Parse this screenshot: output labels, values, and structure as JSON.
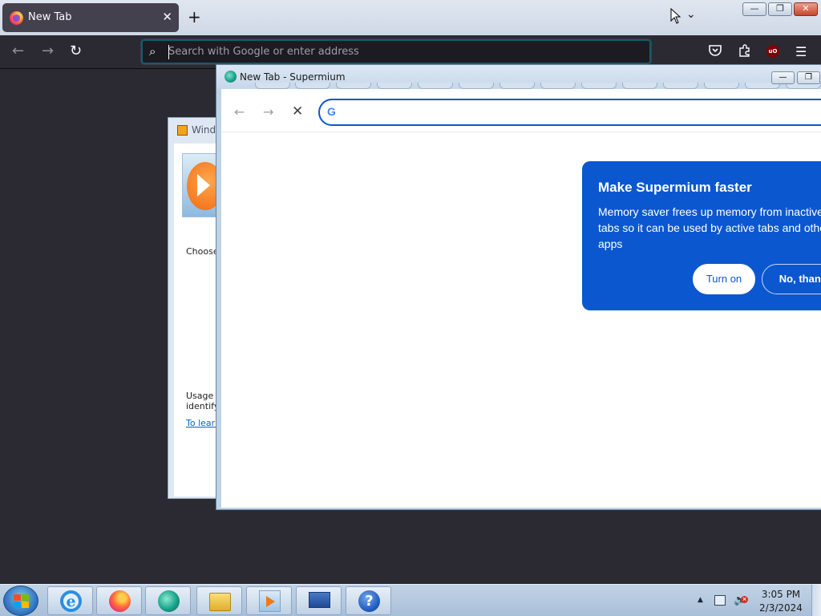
{
  "firefox": {
    "tab_title": "New Tab",
    "tab_close": "✕",
    "new_tab": "+",
    "list_all_tabs": "⌄",
    "window_controls": {
      "minimize": "—",
      "maximize": "❐",
      "close": "✕"
    },
    "nav": {
      "back": "←",
      "forward": "→",
      "reload": "↻"
    },
    "urlbar_placeholder": "Search with Google or enter address",
    "toolbar_icons": [
      "pocket-icon",
      "extensions-icon",
      "ublock-origin-icon",
      "menu-icon"
    ],
    "ublock_badge": "uO",
    "menu_glyph": "☰",
    "accent_color": "#00ddff"
  },
  "wmp_dialog": {
    "title": "Wind",
    "choose_text": "Choose",
    "usage_line1": "Usage c",
    "usage_line2": "identify",
    "link_text": "To learn"
  },
  "supermium": {
    "title": "New Tab - Supermium",
    "window_controls": {
      "minimize": "—",
      "maximize": "❐"
    },
    "nav": {
      "back": "←",
      "forward": "→",
      "stop": "✕"
    },
    "omnibox_value": "",
    "google_glyph": "G",
    "promo": {
      "heading": "Make Supermium faster",
      "body": "Memory saver frees up memory from inactive tabs so it can be used by active tabs and other apps",
      "close": "×",
      "turn_on": "Turn on",
      "no_thanks": "No, thanks"
    },
    "brand_color": "#0b57d0"
  },
  "taskbar": {
    "pinned": [
      "Internet Explorer",
      "Firefox",
      "Supermium",
      "Windows Explorer",
      "Windows Media Player",
      "Network",
      "Help"
    ],
    "ie_glyph": "e",
    "help_glyph": "?",
    "tray_arrow": "▲",
    "volume_glyph": "🔈",
    "volume_muted": "×",
    "clock_time": "3:05 PM",
    "clock_date": "2/3/2024"
  }
}
